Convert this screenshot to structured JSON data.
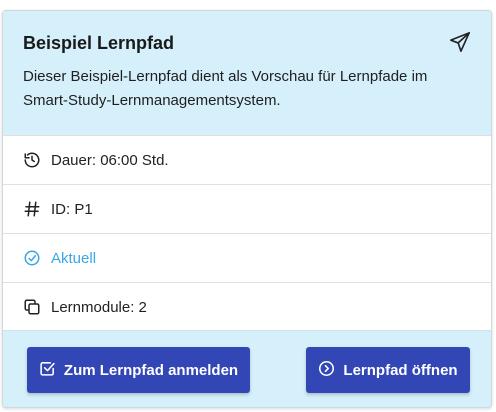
{
  "card": {
    "title": "Beispiel Lernpfad",
    "description": "Dieser Beispiel-Lernpfad dient als Vorschau für Lernpfade im Smart-Study-Lernmanagementsystem.",
    "share_icon": "send-icon"
  },
  "details": {
    "duration": "Dauer: 06:00 Std.",
    "id": "ID: P1",
    "status": "Aktuell",
    "modules": "Lernmodule: 2"
  },
  "actions": {
    "enroll_label": "Zum Lernpfad anmelden",
    "open_label": "Lernpfad öffnen"
  },
  "colors": {
    "header_bg": "#d6f0fb",
    "button_bg": "#3346b5",
    "status_color": "#39a7e6"
  }
}
